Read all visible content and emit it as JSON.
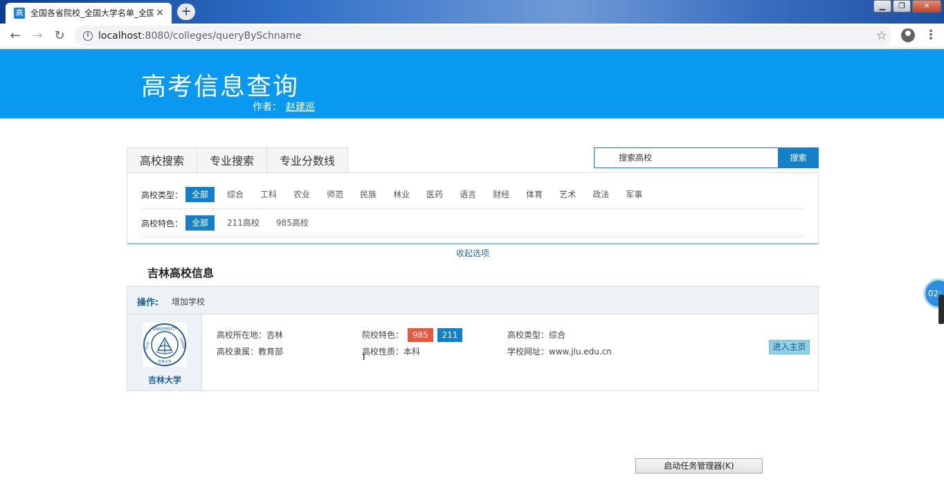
{
  "browser": {
    "tab_favicon": "高",
    "tab_title": "全国各省院校_全国大学名单_全国",
    "tab_close": "✕",
    "new_tab": "+",
    "url_host": "localhost",
    "url_path": ":8080/colleges/queryBySchname",
    "window_buttons": {
      "minimize": "▁",
      "maximize": "❐",
      "close": "✕"
    }
  },
  "header": {
    "site_title": "高考信息查询",
    "author_label": "作者：",
    "author_name": "赵建巡"
  },
  "search_tabs": [
    "高校搜索",
    "专业搜索",
    "专业分数线"
  ],
  "search": {
    "placeholder": "搜索高校",
    "button_label": "搜索"
  },
  "filters": {
    "type": {
      "label": "高校类型：",
      "options": [
        "全部",
        "综合",
        "工科",
        "农业",
        "师范",
        "民族",
        "林业",
        "医药",
        "语言",
        "财经",
        "体育",
        "艺术",
        "政法",
        "军事"
      ],
      "selected": "全部"
    },
    "feature": {
      "label": "高校特色：",
      "options": [
        "全部",
        "211高校",
        "985高校"
      ],
      "selected": "全部"
    },
    "collapse_label": "收起选项"
  },
  "results": {
    "section_title": "吉林高校信息",
    "ops_label": "操作:",
    "add_school": "增加学校",
    "school": {
      "name": "吉林大学",
      "location": "高校所在地：吉林",
      "affiliation": "高校隶属：教育部",
      "feature_label": "院校特色：",
      "badges": [
        "985",
        "211"
      ],
      "nature": "高校性质：本科",
      "type": "高校类型：综合",
      "website": "学校网址：www.jlu.edu.cn",
      "enter_button": "进入主页",
      "logo_text_top": "UNIVERSITY",
      "logo_text_right": "CHINA",
      "logo_text_left": "JILIN",
      "logo_text_bottom": "吉林大学"
    }
  },
  "overlay": {
    "task_manager_button": "启动任务管理器(K)",
    "float_widget_text": "02:"
  },
  "colors": {
    "banner": "#0a99f0",
    "accent": "#1480c8",
    "badge_985": "#e9573f",
    "badge_211": "#1480c8"
  }
}
